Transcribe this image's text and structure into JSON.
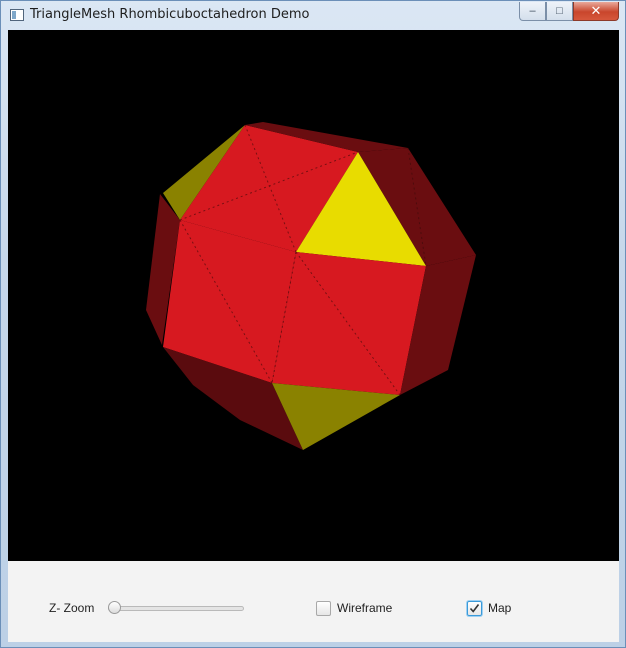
{
  "window": {
    "title": "TriangleMesh Rhombicuboctahedron Demo",
    "minimize_symbol": "–",
    "maximize_symbol": "□",
    "close_symbol": "✕"
  },
  "scene": {
    "background": "#000000",
    "face_colors": {
      "red": "#d71920",
      "dark_red": "#6a0d10",
      "yellow": "#e8dc00",
      "olive": "#8a8200"
    }
  },
  "controls": {
    "zoom_label": "Z- Zoom",
    "zoom_value": 0,
    "wireframe_label": "Wireframe",
    "wireframe_checked": false,
    "map_label": "Map",
    "map_checked": true
  }
}
